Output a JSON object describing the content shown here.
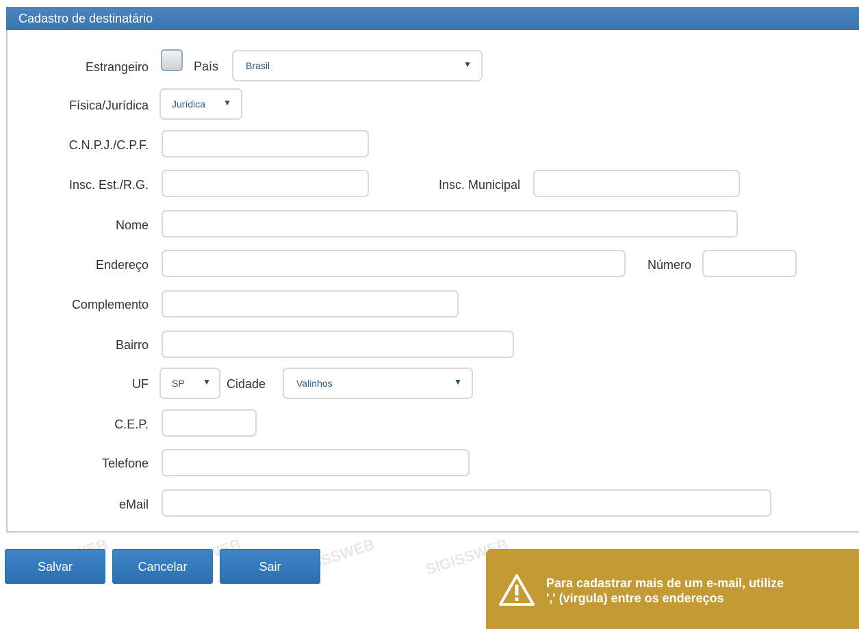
{
  "panel": {
    "title": "Cadastro de destinatário"
  },
  "form": {
    "estrangeiro_label": "Estrangeiro",
    "estrangeiro_checked": false,
    "pais_label": "País",
    "pais_value": "Brasil",
    "tipo_label": "Física/Jurídica",
    "tipo_value": "Jurídica",
    "cnpj_label": "C.N.P.J./C.P.F.",
    "cnpj_value": "",
    "insc_est_label": "Insc. Est./R.G.",
    "insc_est_value": "",
    "insc_mun_label": "Insc. Municipal",
    "insc_mun_value": "",
    "nome_label": "Nome",
    "nome_value": "",
    "endereco_label": "Endereço",
    "endereco_value": "",
    "numero_label": "Número",
    "numero_value": "",
    "complemento_label": "Complemento",
    "complemento_value": "",
    "bairro_label": "Bairro",
    "bairro_value": "",
    "uf_label": "UF",
    "uf_value": "SP",
    "cidade_label": "Cidade",
    "cidade_value": "Valinhos",
    "cep_label": "C.E.P.",
    "cep_value": "",
    "telefone_label": "Telefone",
    "telefone_value": "",
    "email_label": "eMail",
    "email_value": ""
  },
  "buttons": {
    "salvar": "Salvar",
    "cancelar": "Cancelar",
    "sair": "Sair"
  },
  "alert": {
    "line1": "Para cadastrar mais de um e-mail, utilize",
    "line2": "',' (virgula) entre os endereços",
    "icon": "warning-icon"
  },
  "watermark": "SIGISSWEB",
  "colors": {
    "header": "#3b74ad",
    "button": "#2c6fae",
    "alert": "#c49a35"
  }
}
